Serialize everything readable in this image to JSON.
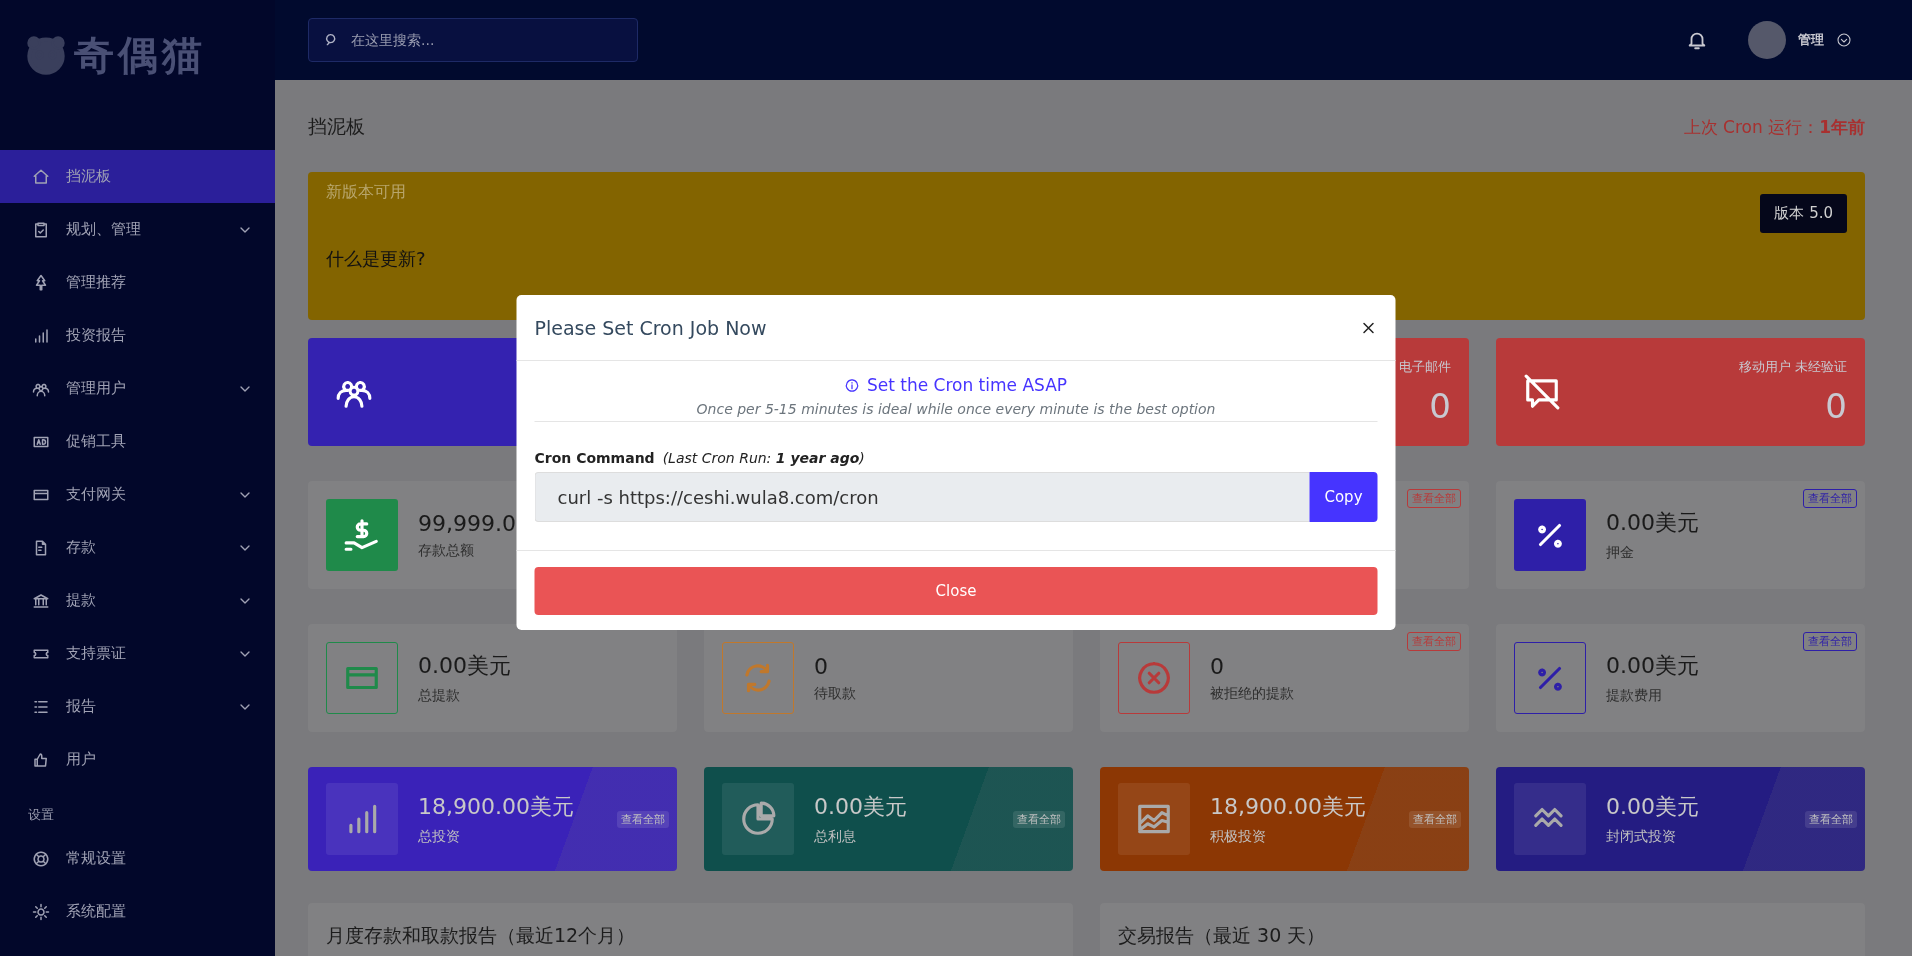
{
  "logo": {
    "text": "奇偶猫"
  },
  "search": {
    "placeholder": "在这里搜索..."
  },
  "user": {
    "name": "管理"
  },
  "sidebar": {
    "items": [
      {
        "label": "挡泥板",
        "selected": true,
        "expandable": false
      },
      {
        "label": "规划、管理",
        "selected": false,
        "expandable": true
      },
      {
        "label": "管理推荐",
        "selected": false,
        "expandable": false
      },
      {
        "label": "投资报告",
        "selected": false,
        "expandable": false
      },
      {
        "label": "管理用户",
        "selected": false,
        "expandable": true
      },
      {
        "label": "促销工具",
        "selected": false,
        "expandable": false
      },
      {
        "label": "支付网关",
        "selected": false,
        "expandable": true
      },
      {
        "label": "存款",
        "selected": false,
        "expandable": true
      },
      {
        "label": "提款",
        "selected": false,
        "expandable": true
      },
      {
        "label": "支持票证",
        "selected": false,
        "expandable": true
      },
      {
        "label": "报告",
        "selected": false,
        "expandable": true
      },
      {
        "label": "用户",
        "selected": false,
        "expandable": false
      }
    ],
    "section_title": "设置",
    "settings_items": [
      {
        "label": "常规设置",
        "selected": false,
        "expandable": false
      },
      {
        "label": "系统配置",
        "selected": false,
        "expandable": false
      }
    ]
  },
  "page": {
    "title": "挡泥板",
    "cron_status": "上次 Cron 运行：**1年前**"
  },
  "banner": {
    "title": "新版本可用",
    "text": "什么是更新?",
    "version_button": "版本 5.0"
  },
  "stat_rows": [
    {
      "kind": "solid",
      "cards": [
        {
          "kind": "stat",
          "color": "#3422b0"
        },
        {
          "kind": "covered"
        },
        {
          "kind": "stat",
          "color": "#b83a3a",
          "label": "电子邮件",
          "value": "0"
        },
        {
          "kind": "stat",
          "color": "#b83a3a",
          "label": "移动用户 未经验证",
          "value": "0"
        }
      ]
    },
    {
      "kind": "filled",
      "cards": [
        {
          "kind": "stat",
          "color": "#1f8a4a",
          "value": "99,999.0",
          "label": "存款总额"
        },
        {
          "kind": "covered"
        },
        {
          "kind": "stat",
          "color": "#b83a3a",
          "badge": "查看全部"
        },
        {
          "kind": "stat",
          "color": "#2e1fa8",
          "value": "0.00美元",
          "label": "押金",
          "badge": "查看全部"
        }
      ]
    },
    {
      "kind": "outline",
      "cards": [
        {
          "kind": "stat",
          "color": "#1f8a4a",
          "value": "0.00美元",
          "label": "总提款"
        },
        {
          "kind": "stat",
          "color": "#c0782c",
          "value": "0",
          "label": "待取款"
        },
        {
          "kind": "stat",
          "color": "#b83a3a",
          "value": "0",
          "label": "被拒绝的提款",
          "badge": "查看全部"
        },
        {
          "kind": "stat",
          "color": "#2e1fa8",
          "value": "0.00美元",
          "label": "提款费用",
          "badge": "查看全部"
        }
      ]
    },
    {
      "kind": "gradient",
      "cards": [
        {
          "kind": "stat",
          "color": "#3a22b8",
          "value": "18,900.00美元",
          "label": "总投资",
          "badge": "查看全部"
        },
        {
          "kind": "stat",
          "color": "#0f4f4c",
          "value": "0.00美元",
          "label": "总利息",
          "badge": "查看全部"
        },
        {
          "kind": "stat",
          "color": "#8c3704",
          "value": "18,900.00美元",
          "label": "积极投资",
          "badge": "查看全部"
        },
        {
          "kind": "stat",
          "color": "#241c82",
          "value": "0.00美元",
          "label": "封闭式投资",
          "badge": "查看全部"
        }
      ]
    }
  ],
  "reports": [
    {
      "title": "月度存款和取款报告（最近12个月）"
    },
    {
      "title": "交易报告（最近 30 天）"
    }
  ],
  "modal": {
    "title": "Please Set Cron Job Now",
    "notice": "Set the Cron time ASAP",
    "hint": "Once per 5-15 minutes is ideal while once every minute is the best option",
    "command_label": "Cron Command",
    "last_run": "(Last Cron Run: **1 year ago**)",
    "command": "curl -s https://ceshi.wula8.com/cron",
    "copy_button": "Copy",
    "close_button": "Close"
  }
}
